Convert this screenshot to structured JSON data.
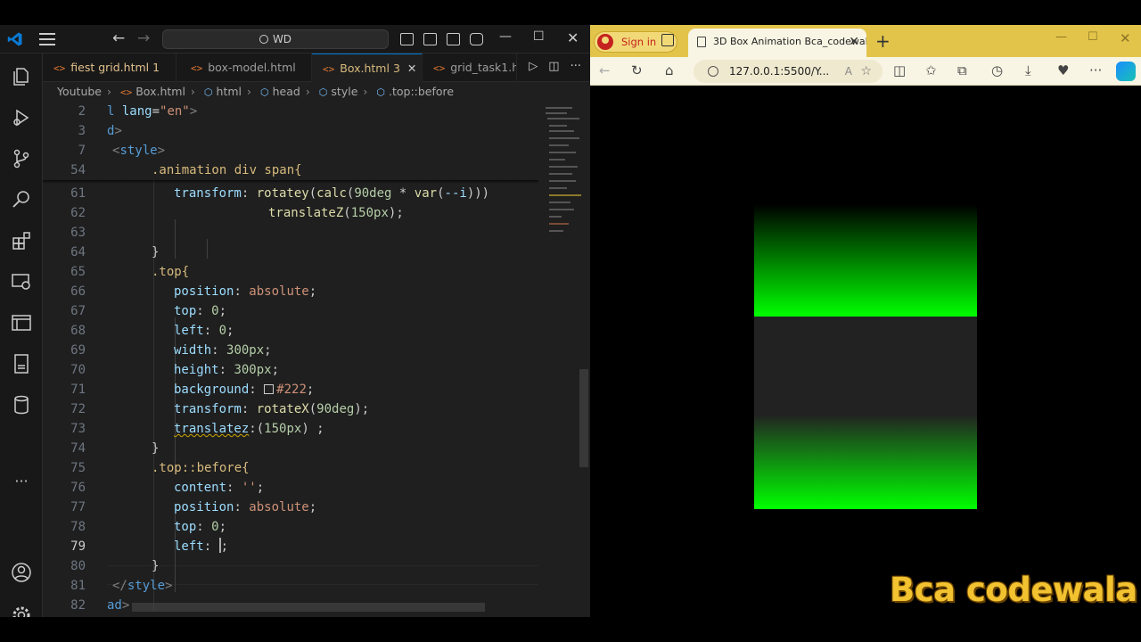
{
  "vscode": {
    "title_search": "WD",
    "tabs": [
      {
        "label": "fiest grid.html",
        "badge": "1",
        "modified": true,
        "active": false
      },
      {
        "label": "box-model.html",
        "badge": "",
        "modified": false,
        "active": false
      },
      {
        "label": "Box.html",
        "badge": "3",
        "modified": true,
        "active": true
      },
      {
        "label": "grid_task1.h",
        "badge": "",
        "modified": false,
        "active": false
      }
    ],
    "breadcrumb": [
      "Youtube",
      "Box.html",
      "html",
      "head",
      "style",
      ".top::before"
    ],
    "sticky_lines": [
      {
        "num": "2",
        "text": "l lang=\"en\">"
      },
      {
        "num": "3",
        "text": "d>"
      },
      {
        "num": "7",
        "text": "<style>"
      },
      {
        "num": "54",
        "text": ".animation div span{"
      }
    ],
    "lines": [
      {
        "num": "61",
        "text": "transform: rotatey(calc(90deg * var(--i)))"
      },
      {
        "num": "62",
        "text": "translateZ(150px);"
      },
      {
        "num": "63",
        "text": ""
      },
      {
        "num": "64",
        "text": "}"
      },
      {
        "num": "65",
        "text": ".top{"
      },
      {
        "num": "66",
        "text": "position: absolute;"
      },
      {
        "num": "67",
        "text": "top: 0;"
      },
      {
        "num": "68",
        "text": "left: 0;"
      },
      {
        "num": "69",
        "text": "width: 300px;"
      },
      {
        "num": "70",
        "text": "height: 300px;"
      },
      {
        "num": "71",
        "text": "background: #222;"
      },
      {
        "num": "72",
        "text": "transform: rotateX(90deg);"
      },
      {
        "num": "73",
        "text": "translatez:(150px) ;"
      },
      {
        "num": "74",
        "text": "}"
      },
      {
        "num": "75",
        "text": ".top::before{"
      },
      {
        "num": "76",
        "text": "content: '';"
      },
      {
        "num": "77",
        "text": "position: absolute;"
      },
      {
        "num": "78",
        "text": "top: 0;"
      },
      {
        "num": "79",
        "text": "left: ;"
      },
      {
        "num": "80",
        "text": "}"
      },
      {
        "num": "81",
        "text": "</style>"
      },
      {
        "num": "82",
        "text": "ad>"
      }
    ]
  },
  "browser": {
    "signin_label": "Sign in",
    "tab_title": "3D Box Animation Bca_codewala",
    "address": "127.0.0.1:5500/Y...",
    "reader_label": "A"
  },
  "cube": {
    "accent": "#00ff00",
    "face_color": "#222222"
  },
  "watermark": "Bca codewala"
}
